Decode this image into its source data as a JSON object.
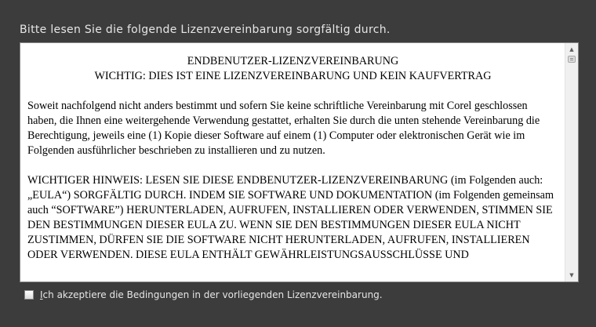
{
  "heading": "Bitte lesen Sie die folgende Lizenzvereinbarung sorgfältig durch.",
  "license": {
    "title_line1": "ENDBENUTZER-LIZENZVEREINBARUNG",
    "title_line2": "WICHTIG: DIES IST EINE LIZENZVEREINBARUNG UND KEIN KAUFVERTRAG",
    "paragraph1": "Soweit nachfolgend nicht anders bestimmt und sofern Sie  keine schriftliche Vereinbarung mit Corel geschlossen haben, die Ihnen eine weitergehende Verwendung gestattet, erhalten Sie durch die unten stehende Vereinbarung die Berechtigung, jeweils eine (1) Kopie dieser Software auf einem (1) Computer oder elektronischen Gerät wie im Folgenden ausführlicher beschrieben zu installieren und zu nutzen.",
    "paragraph2": "WICHTIGER HINWEIS: LESEN SIE DIESE ENDBENUTZER-LIZENZVEREINBARUNG (im Folgenden auch: „EULA“) SORGFÄLTIG DURCH. INDEM SIE SOFTWARE UND DOKUMENTATION (im Folgenden gemeinsam auch “SOFTWARE”) HERUNTERLADEN, AUFRUFEN, INSTALLIEREN ODER VERWENDEN, STIMMEN SIE DEN BESTIMMUNGEN DIESER EULA ZU. WENN SIE DEN BESTIMMUNGEN DIESER EULA NICHT ZUSTIMMEN, DÜRFEN SIE DIE SOFTWARE NICHT HERUNTERLADEN, AUFRUFEN, INSTALLIEREN ODER VERWENDEN. DIESE EULA ENTHÄLT GEWÄHRLEISTUNGSAUSSCHLÜSSE UND"
  },
  "accept": {
    "mnemonic": "I",
    "label_rest": "ch akzeptiere die Bedingungen in der vorliegenden Lizenzvereinbarung.",
    "checked": false
  },
  "colors": {
    "background": "#3b3c3b",
    "text_light": "#e6e6e6",
    "box_background": "#ffffff"
  }
}
